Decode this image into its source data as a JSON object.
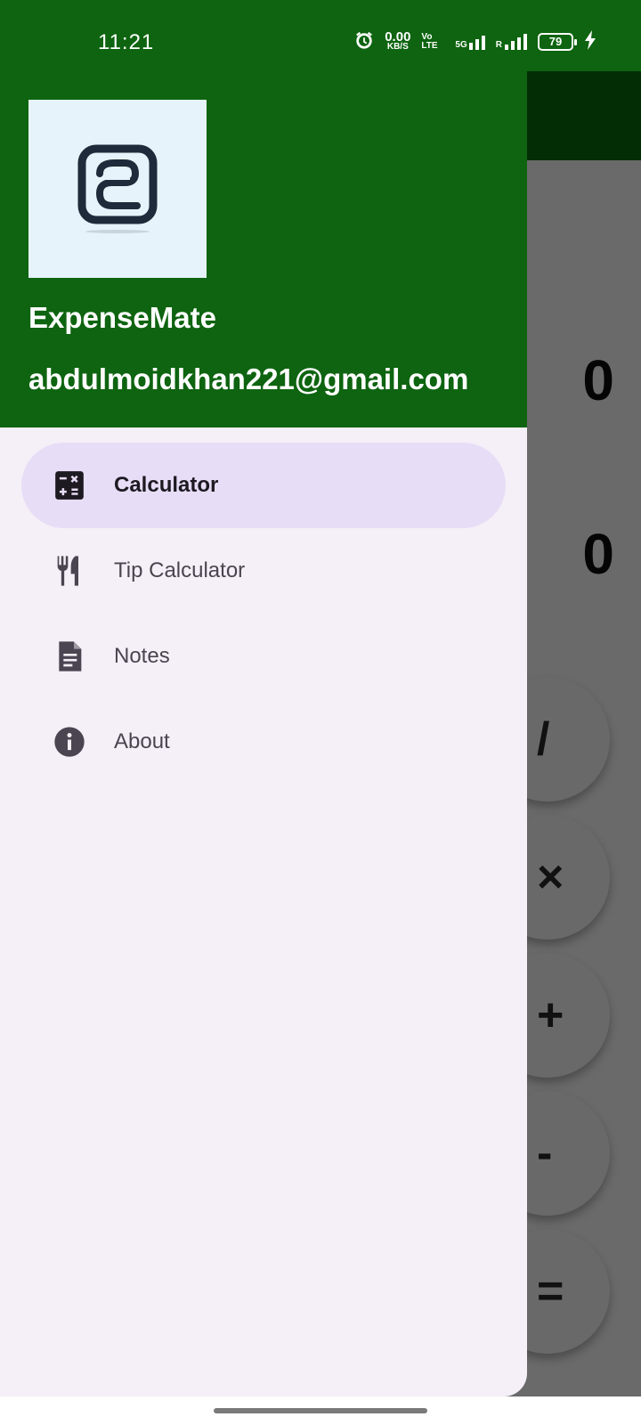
{
  "status_bar": {
    "time": "11:21",
    "net_speed": "0.00",
    "net_speed_unit": "KB/S",
    "volte": "Vo LTE",
    "network": "5G",
    "roaming": "R",
    "battery": "79",
    "icons": [
      "alarm-icon",
      "signal-5g-icon",
      "signal-icon",
      "battery-charging-icon"
    ]
  },
  "drawer": {
    "header": {
      "app_name": "ExpenseMate",
      "email": "abdulmoidkhan221@gmail.com",
      "logo_icon": "expensemate-logo"
    },
    "items": [
      {
        "label": "Calculator",
        "icon": "calculator-icon",
        "active": true
      },
      {
        "label": "Tip Calculator",
        "icon": "restaurant-icon",
        "active": false
      },
      {
        "label": "Notes",
        "icon": "note-icon",
        "active": false
      },
      {
        "label": "About",
        "icon": "info-icon",
        "active": false
      }
    ]
  },
  "background_app": {
    "display_values": [
      "0",
      "0"
    ],
    "operator_buttons": [
      "/",
      "×",
      "+",
      "-",
      "="
    ]
  },
  "colors": {
    "header_green": "#0e6410",
    "app_bar_dark_green": "#032d05",
    "drawer_bg": "#f5eff7",
    "active_item_bg": "#e8ddf6",
    "scrim": "#6a6a6a"
  }
}
